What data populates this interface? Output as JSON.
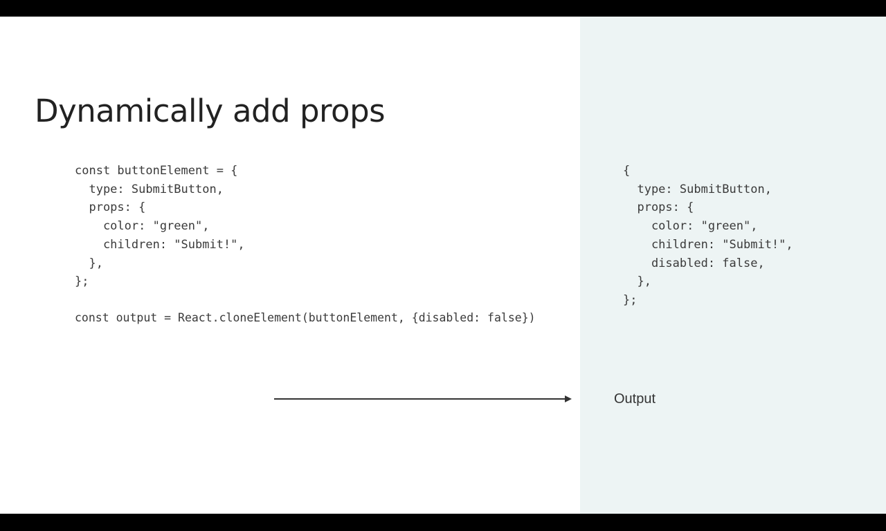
{
  "slide": {
    "title": "Dynamically add props",
    "code_element": "const buttonElement = {\n  type: SubmitButton,\n  props: {\n    color: \"green\",\n    children: \"Submit!\",\n  },\n};",
    "code_call": "const output = React.cloneElement(buttonElement, {disabled: false})",
    "output_code": "{\n  type: SubmitButton,\n  props: {\n    color: \"green\",\n    children: \"Submit!\",\n    disabled: false,\n  },\n};",
    "output_label": "Output"
  },
  "colors": {
    "background": "#ffffff",
    "output_panel": "#edf4f4",
    "title_text": "#222222",
    "code_text": "#3a3a3a",
    "arrow": "#333333"
  },
  "icons": {
    "arrow": "arrow-right-icon"
  }
}
